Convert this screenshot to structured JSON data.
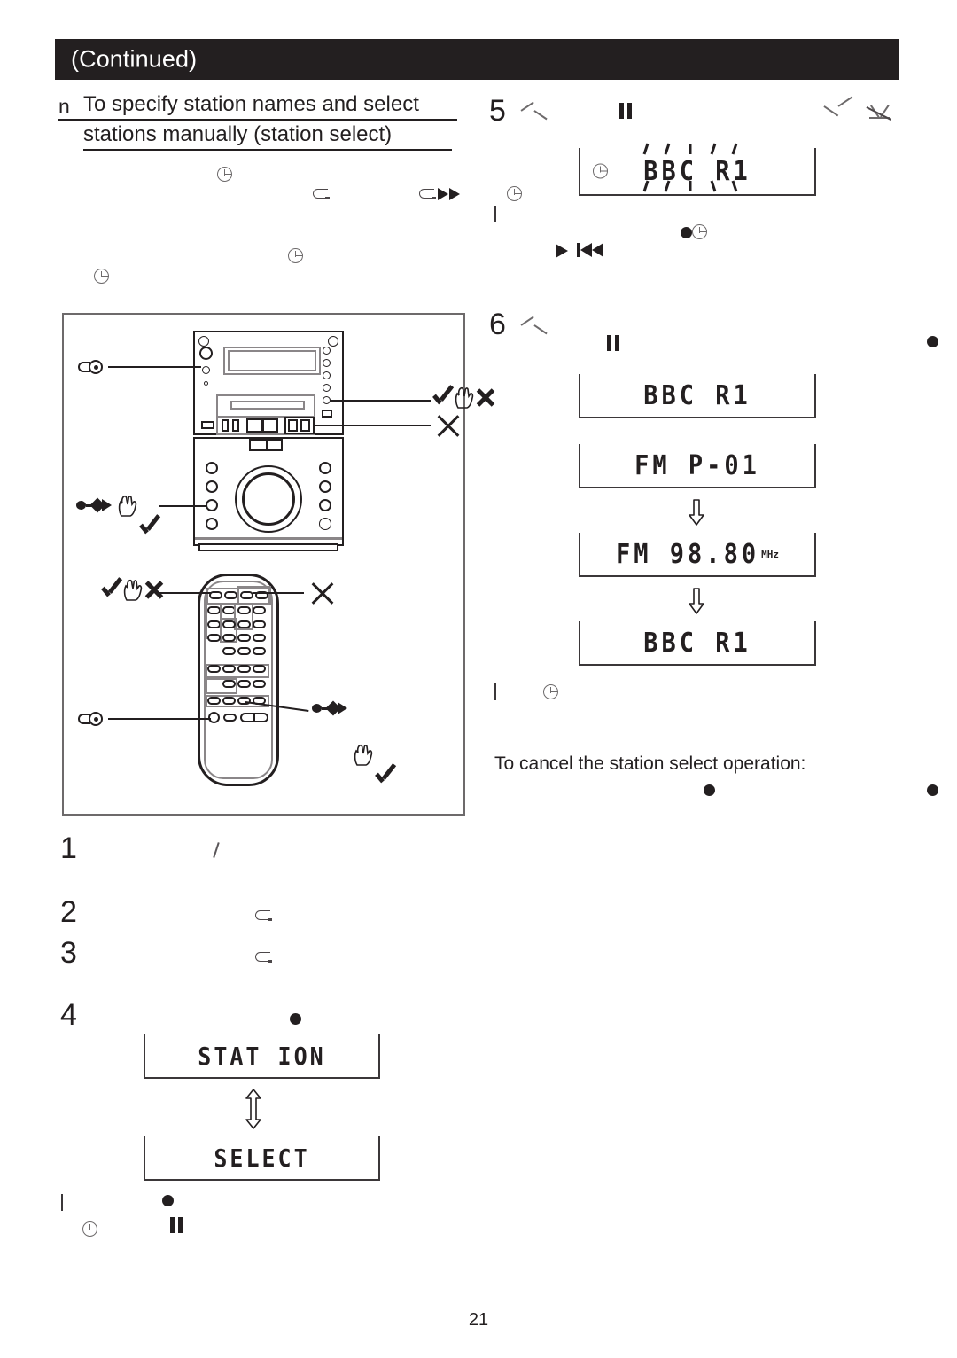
{
  "header": {
    "title": "(Continued)",
    "bullet": "n"
  },
  "section": {
    "heading_line1": "To specify station names and select",
    "heading_line2": "stations manually (station select)"
  },
  "steps": {
    "one": "1",
    "two": "2",
    "three": "3",
    "four": "4",
    "five": "5",
    "six": "6"
  },
  "displays": {
    "station": "STAT ION",
    "select": "SELECT",
    "bbc_blinking": "BBC R1",
    "bbc_plain": "BBC R1",
    "fm_preset": "FM  P-01",
    "fm_freq": "FM  98.80",
    "fm_unit": "MHz",
    "bbc_final": "BBC R1"
  },
  "notes": {
    "cancel": "To cancel the station select operation:"
  },
  "icons": {
    "clock": "clock-icon",
    "pause": "pause-icon",
    "play": "play-icon",
    "prev": "previous-track-icon",
    "fast_forward": "fast-forward-icon",
    "repeat": "repeat-icon",
    "chevron_up": "chevron-up-icon",
    "chevron_down": "chevron-down-icon",
    "no_signal": "crossed-triangle-icon",
    "bullet_dot": "bullet-dot-icon",
    "x_mark": "x-mark-icon",
    "check": "check-mark-icon",
    "hand": "hand-icon",
    "key": "key-icon",
    "pointer": "pointer-icon",
    "arrow_down": "down-arrow-icon",
    "arrow_updown": "up-down-arrow-icon"
  },
  "colors": {
    "ink": "#231f20",
    "gray": "#6d6a6b",
    "header_bg": "#231f20",
    "header_fg": "#ffffff"
  },
  "footer": {
    "page_number": "21"
  }
}
